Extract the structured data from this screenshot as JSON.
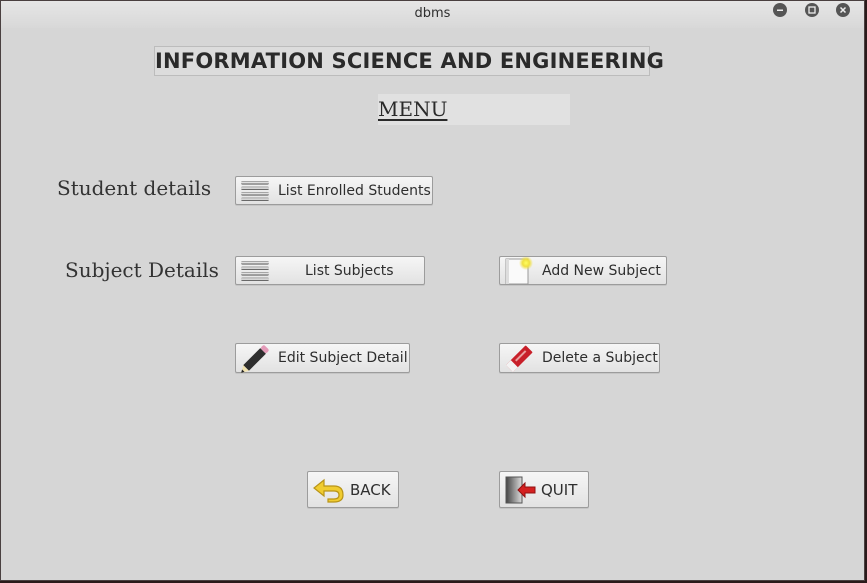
{
  "window": {
    "title": "dbms",
    "controls": {
      "minimize": "minimize",
      "maximize": "maximize",
      "close": "close"
    }
  },
  "header": {
    "department": "INFORMATION SCIENCE AND ENGINEERING",
    "menu_label": "MENU"
  },
  "sections": {
    "student": {
      "label": "Student details",
      "buttons": [
        {
          "label": "List Enrolled Students",
          "icon": "list-icon"
        }
      ]
    },
    "subject": {
      "label": "Subject Details",
      "buttons": [
        {
          "label": "List Subjects",
          "icon": "list-icon"
        },
        {
          "label": "Add New Subject",
          "icon": "new-document-icon"
        },
        {
          "label": "Edit Subject Detail",
          "icon": "pencil-icon"
        },
        {
          "label": "Delete a Subject",
          "icon": "eraser-icon"
        }
      ]
    }
  },
  "footer": {
    "back_label": "BACK",
    "quit_label": "QUIT"
  },
  "colors": {
    "window_bg": "#d6d6d6",
    "button_bg": "#eeeeee",
    "heading_bg": "#dcdcdc",
    "back_arrow": "#e8c22a",
    "quit_arrow": "#d42020",
    "eraser": "#c8202a"
  }
}
